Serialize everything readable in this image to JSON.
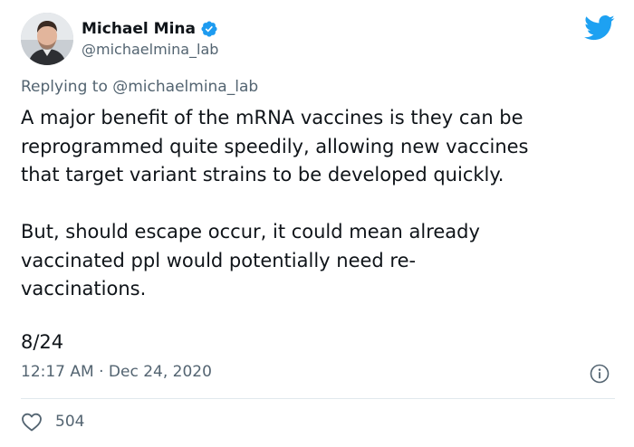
{
  "author": {
    "name": "Michael Mina",
    "handle": "@michaelmina_lab",
    "verified": true
  },
  "reply": {
    "prefix": "Replying to ",
    "mention": "@michaelmina_lab"
  },
  "tweet": {
    "paragraph1_lines": [
      "A major benefit of the mRNA vaccines is they can be",
      "reprogrammed quite speedily, allowing new vaccines",
      "that target variant strains to be developed quickly."
    ],
    "paragraph2_lines": [
      "But, should escape occur, it could mean already",
      "vaccinated ppl would potentially need re-",
      "vaccinations."
    ],
    "thread_count": "8/24"
  },
  "meta": {
    "timestamp": "12:17 AM · Dec 24, 2020"
  },
  "engagement": {
    "likes": "504"
  },
  "icons": {
    "brand": "twitter-bird-icon",
    "verified": "verified-badge-icon",
    "info": "info-icon",
    "like": "heart-icon"
  },
  "colors": {
    "brand_blue": "#1da1f2",
    "text_primary": "#0f1419",
    "text_secondary": "#536471",
    "divider": "#e1e8ed"
  }
}
